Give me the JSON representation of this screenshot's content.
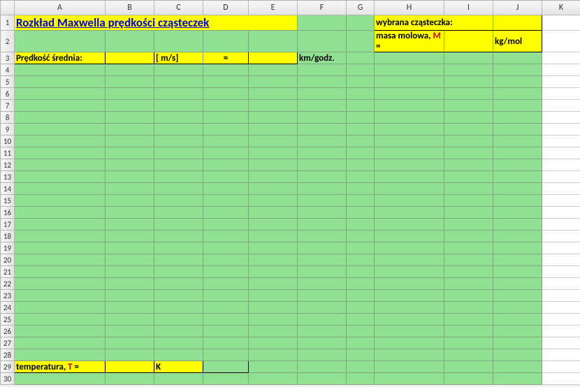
{
  "columns": [
    "",
    "A",
    "B",
    "C",
    "D",
    "E",
    "F",
    "G",
    "H",
    "I",
    "J",
    "K"
  ],
  "row_numbers": [
    1,
    2,
    3,
    4,
    5,
    6,
    7,
    8,
    9,
    10,
    11,
    12,
    13,
    14,
    15,
    16,
    17,
    18,
    19,
    20,
    21,
    22,
    23,
    24,
    25,
    26,
    27,
    28,
    29,
    30
  ],
  "title": "Rozkład Maxwella prędkości cząsteczek",
  "chosen_particle_label": "wybrana cząsteczka:",
  "molar_mass": {
    "label": "masa molowa, ",
    "symbol": "M",
    "equals": " =",
    "value": "",
    "unit": "kg/mol"
  },
  "avg_speed": {
    "label": "Prędkość średnia:",
    "value_ms": "",
    "unit_ms": "[ m/s]",
    "equals": "=",
    "value_kmh": "",
    "unit_kmh": "km/godz."
  },
  "temperature": {
    "label": "temperatura, ",
    "symbol": "T",
    "equals": " =",
    "value": "",
    "unit": "K"
  }
}
